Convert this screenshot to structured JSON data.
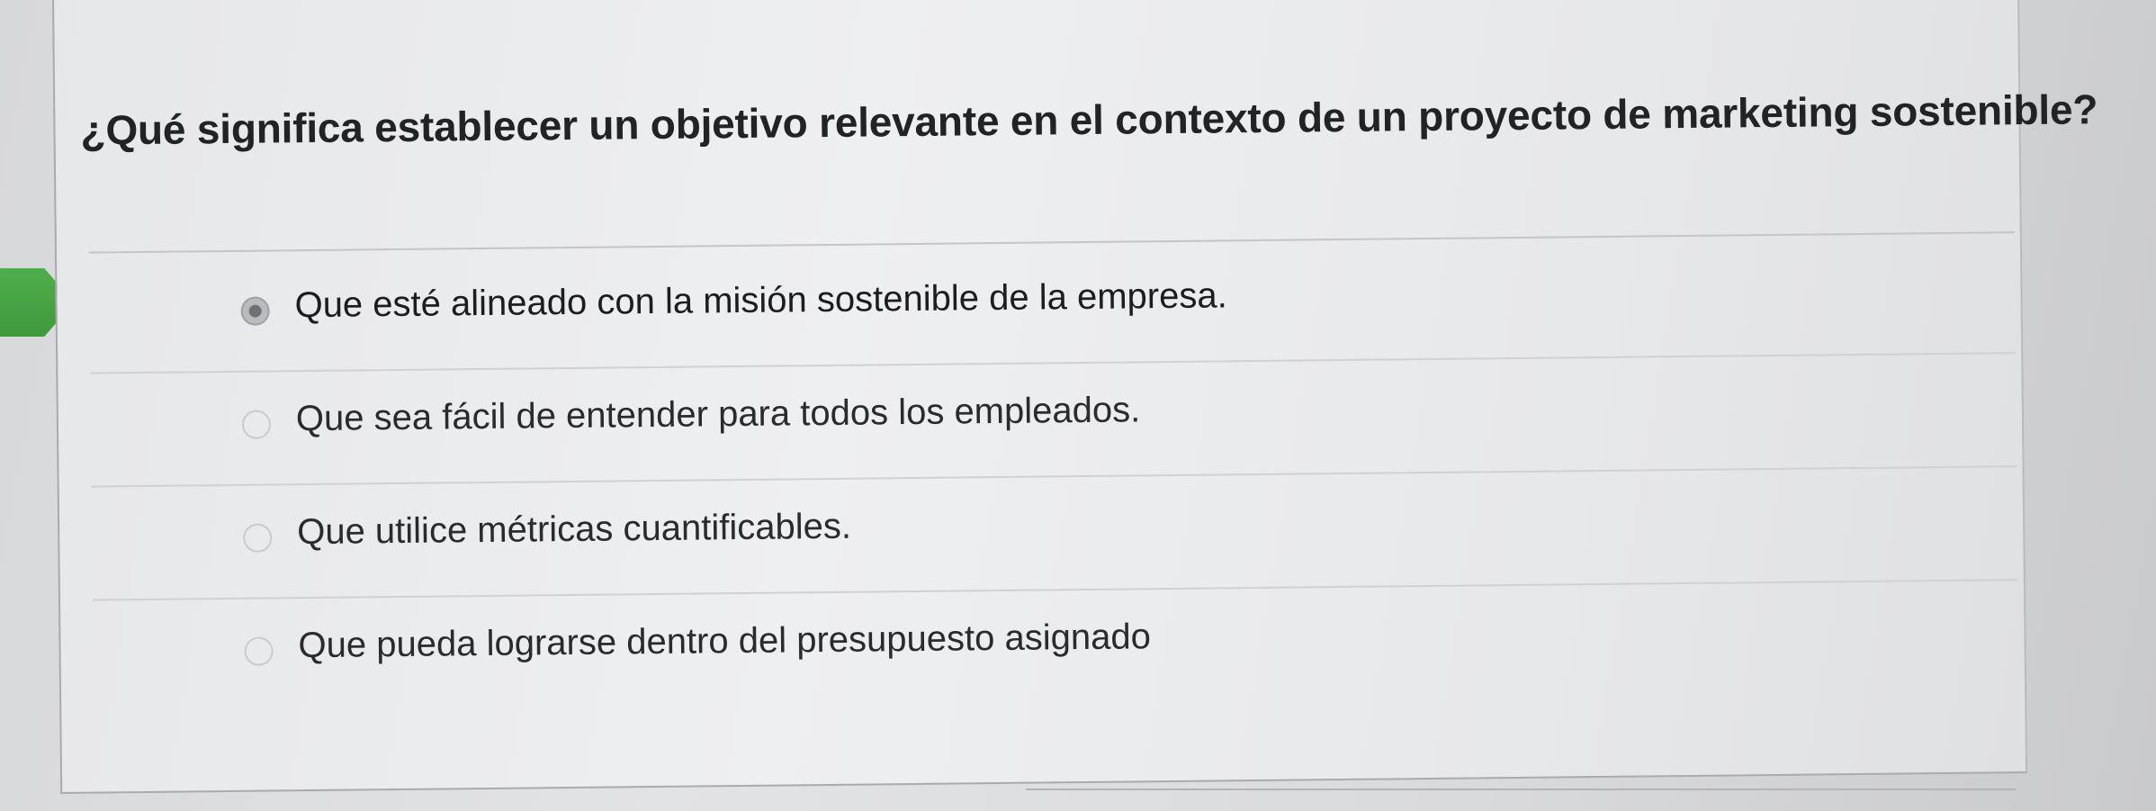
{
  "question": {
    "text": "¿Qué significa establecer un objetivo relevante en el contexto de un proyecto de marketing sostenible?"
  },
  "answers": [
    {
      "label": "Que esté alineado con la misión sostenible de la empresa.",
      "selected": true
    },
    {
      "label": "Que sea fácil de entender para todos los empleados.",
      "selected": false
    },
    {
      "label": "Que utilice métricas cuantificables.",
      "selected": false
    },
    {
      "label": "Que pueda lograrse dentro del presupuesto asignado",
      "selected": false
    }
  ],
  "colors": {
    "marker": "#4fae4b",
    "card": "#eeeff0",
    "text": "#222324"
  },
  "icons": {
    "marker": "current-question-arrow-icon",
    "radio_selected": "radio-selected-icon",
    "radio_unselected": "radio-unselected-icon"
  }
}
